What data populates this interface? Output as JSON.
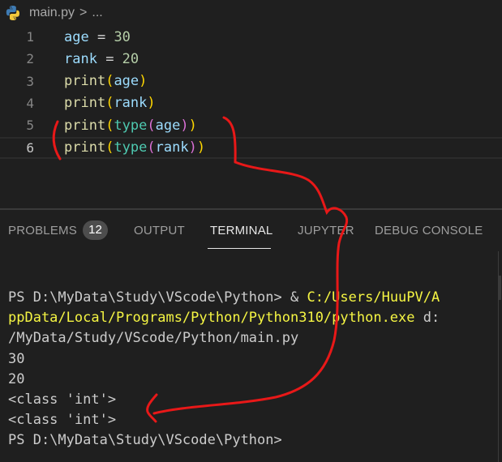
{
  "breadcrumb": {
    "icon": "python-icon",
    "file": "main.py",
    "separator": ">",
    "more": "..."
  },
  "editor": {
    "lines": [
      {
        "number": "1",
        "tokens": [
          {
            "t": "age",
            "c": "var"
          },
          {
            "t": " = ",
            "c": "op"
          },
          {
            "t": "30",
            "c": "num"
          }
        ]
      },
      {
        "number": "2",
        "tokens": [
          {
            "t": "rank",
            "c": "var"
          },
          {
            "t": " = ",
            "c": "op"
          },
          {
            "t": "20",
            "c": "num"
          }
        ]
      },
      {
        "number": "3",
        "tokens": [
          {
            "t": "print",
            "c": "fn"
          },
          {
            "t": "(",
            "c": "p1"
          },
          {
            "t": "age",
            "c": "var"
          },
          {
            "t": ")",
            "c": "p1"
          }
        ]
      },
      {
        "number": "4",
        "tokens": [
          {
            "t": "print",
            "c": "fn"
          },
          {
            "t": "(",
            "c": "p1"
          },
          {
            "t": "rank",
            "c": "var"
          },
          {
            "t": ")",
            "c": "p1"
          }
        ]
      },
      {
        "number": "5",
        "tokens": [
          {
            "t": "print",
            "c": "fn"
          },
          {
            "t": "(",
            "c": "p1"
          },
          {
            "t": "type",
            "c": "bi"
          },
          {
            "t": "(",
            "c": "p2"
          },
          {
            "t": "age",
            "c": "var"
          },
          {
            "t": ")",
            "c": "p2"
          },
          {
            "t": ")",
            "c": "p1"
          }
        ]
      },
      {
        "number": "6",
        "tokens": [
          {
            "t": "print",
            "c": "fn"
          },
          {
            "t": "(",
            "c": "p1"
          },
          {
            "t": "type",
            "c": "bi"
          },
          {
            "t": "(",
            "c": "p2"
          },
          {
            "t": "rank",
            "c": "var"
          },
          {
            "t": ")",
            "c": "p2"
          },
          {
            "t": ")",
            "c": "p1"
          }
        ]
      }
    ],
    "current_line": "6"
  },
  "panel": {
    "tabs": [
      {
        "label": "PROBLEMS",
        "active": false
      },
      {
        "label": "OUTPUT",
        "active": false
      },
      {
        "label": "TERMINAL",
        "active": true
      },
      {
        "label": "JUPYTER",
        "active": false
      },
      {
        "label": "DEBUG CONSOLE",
        "active": false
      }
    ],
    "problems_count": "12"
  },
  "terminal": {
    "lines": [
      [
        {
          "t": "PS D:\\MyData\\Study\\VScode\\Python> & ",
          "c": ""
        },
        {
          "t": "C:/Users/HuuPV/A",
          "c": "yellow"
        }
      ],
      [
        {
          "t": "ppData/Local/Programs/Python/Python310/python.exe",
          "c": "yellow"
        },
        {
          "t": " d:",
          "c": ""
        }
      ],
      [
        {
          "t": "/MyData/Study/VScode/Python/main.py",
          "c": ""
        }
      ],
      [
        {
          "t": "30",
          "c": ""
        }
      ],
      [
        {
          "t": "20",
          "c": ""
        }
      ],
      [
        {
          "t": "<class 'int'>",
          "c": ""
        }
      ],
      [
        {
          "t": "<class 'int'>",
          "c": ""
        }
      ],
      [
        {
          "t": "PS D:\\MyData\\Study\\VScode\\Python>",
          "c": ""
        }
      ]
    ]
  },
  "colors": {
    "background": "#1f1f1f",
    "annotation": "#e81818",
    "terminal_yellow": "#f5f543"
  }
}
